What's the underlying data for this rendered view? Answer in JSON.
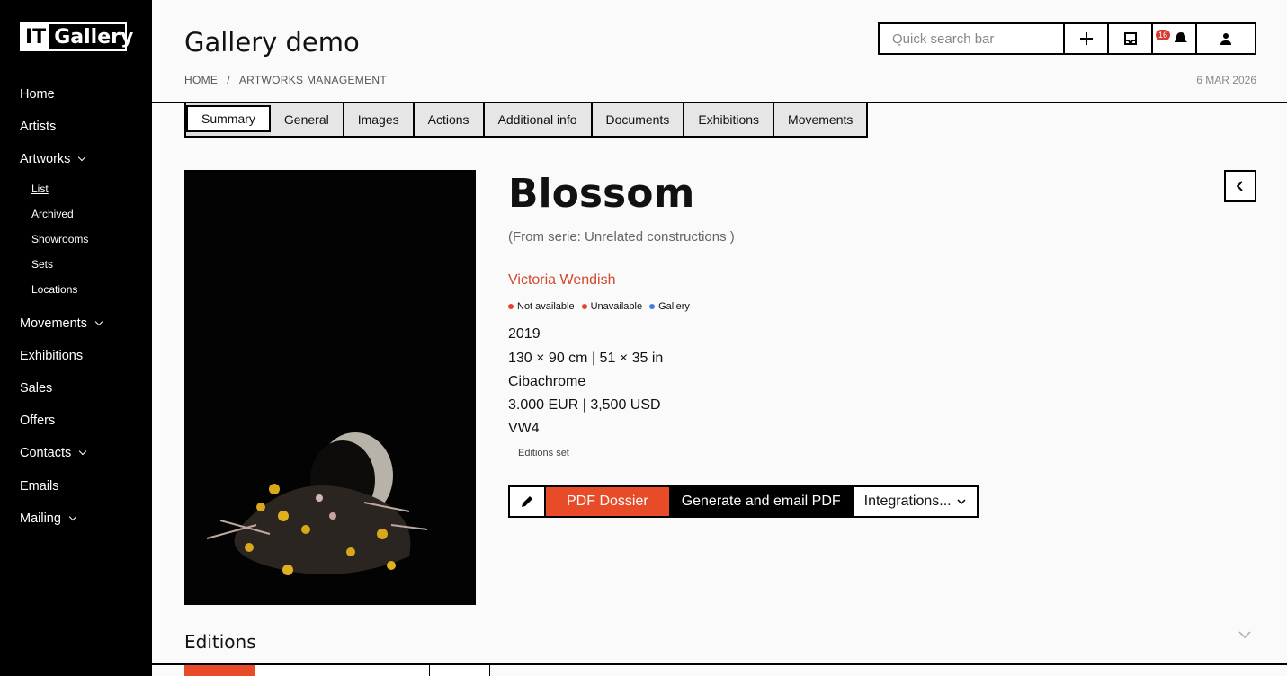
{
  "sidebar": {
    "logo_left": "IT",
    "logo_right": "Gallery",
    "items": [
      {
        "label": "Home"
      },
      {
        "label": "Artists"
      },
      {
        "label": "Artworks"
      },
      {
        "label": "Movements"
      },
      {
        "label": "Exhibitions"
      },
      {
        "label": "Sales"
      },
      {
        "label": "Offers"
      },
      {
        "label": "Contacts"
      },
      {
        "label": "Emails"
      },
      {
        "label": "Mailing"
      }
    ],
    "artworks_sub": [
      {
        "label": "List"
      },
      {
        "label": "Archived"
      },
      {
        "label": "Showrooms"
      },
      {
        "label": "Sets"
      },
      {
        "label": "Locations"
      }
    ]
  },
  "header": {
    "title": "Gallery demo",
    "breadcrumb": [
      "HOME",
      "/",
      "ARTWORKS MANAGEMENT"
    ],
    "date": "6 MAR 2026",
    "search_placeholder": "Quick search bar",
    "notifications_count": "16"
  },
  "tabs": [
    {
      "label": "Summary"
    },
    {
      "label": "General"
    },
    {
      "label": "Images"
    },
    {
      "label": "Actions"
    },
    {
      "label": "Additional info"
    },
    {
      "label": "Documents"
    },
    {
      "label": "Exhibitions"
    },
    {
      "label": "Movements"
    }
  ],
  "artwork": {
    "title": "Blossom",
    "serie": "(From serie: Unrelated constructions )",
    "artist": "Victoria Wendish",
    "tags": [
      {
        "label": "Not available",
        "color": "#e2452b"
      },
      {
        "label": "Unavailable",
        "color": "#e2452b"
      },
      {
        "label": "Gallery",
        "color": "#3f7fe0"
      }
    ],
    "year": "2019",
    "dimensions": "130 × 90 cm | 51 × 35 in",
    "technique": "Cibachrome",
    "price": "3.000 EUR | 3,500 USD",
    "reference": "VW4",
    "editions_set": "Editions set"
  },
  "actions": {
    "pdf": "PDF Dossier",
    "generate": "Generate and email PDF",
    "integrations": "Integrations..."
  },
  "sections": {
    "editions": "Editions"
  },
  "colors": {
    "accent": "#e84b27",
    "artist": "#d04a2f"
  }
}
